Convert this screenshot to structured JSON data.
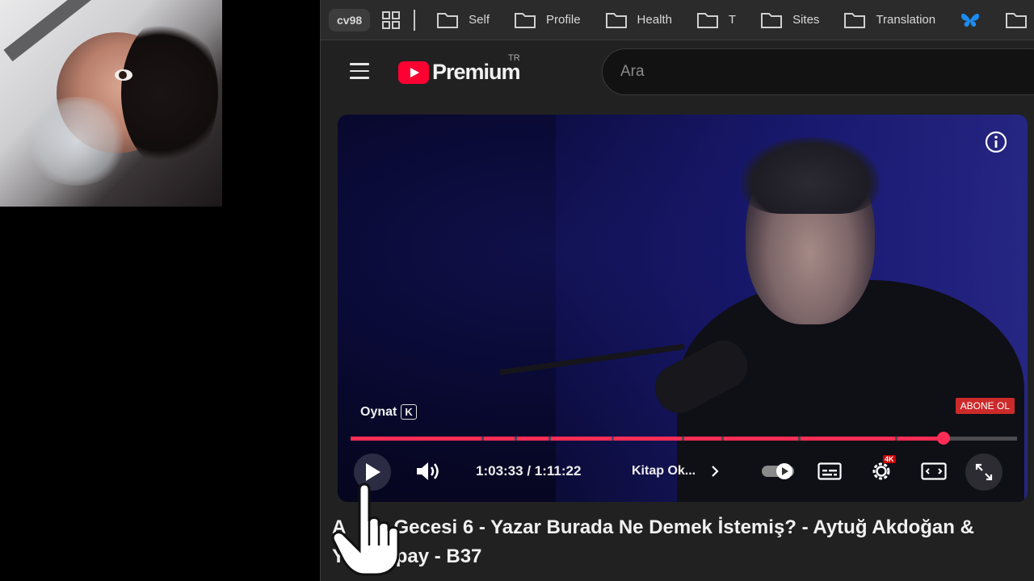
{
  "bookmarks_bar": {
    "profile": "cv98",
    "items": [
      {
        "label": "Self"
      },
      {
        "label": "Profile"
      },
      {
        "label": "Health"
      },
      {
        "label": "T"
      },
      {
        "label": "Sites"
      },
      {
        "label": "Translation"
      }
    ]
  },
  "youtube": {
    "logo_text": "Premium",
    "region": "TR",
    "search_placeholder": "Ara"
  },
  "player": {
    "tooltip_label": "Oynat",
    "tooltip_key": "K",
    "subscribe_label": "ABONE OL",
    "time_current": "1:03:33",
    "time_separator": " / ",
    "time_total": "1:11:22",
    "chapter_label": "Kitap Ok...",
    "settings_badge": "4K",
    "progress_fraction": 0.89
  },
  "video": {
    "title_line1": "A      a Gecesi 6 - Yazar Burada Ne Demek İstemiş? - Aytuğ Akdoğan &",
    "title_line2": "Y      Alpay - B37"
  },
  "colors": {
    "accent": "#ff2d55",
    "youtube_red": "#ff0033",
    "subscribe_bg": "#cc2a2a"
  }
}
